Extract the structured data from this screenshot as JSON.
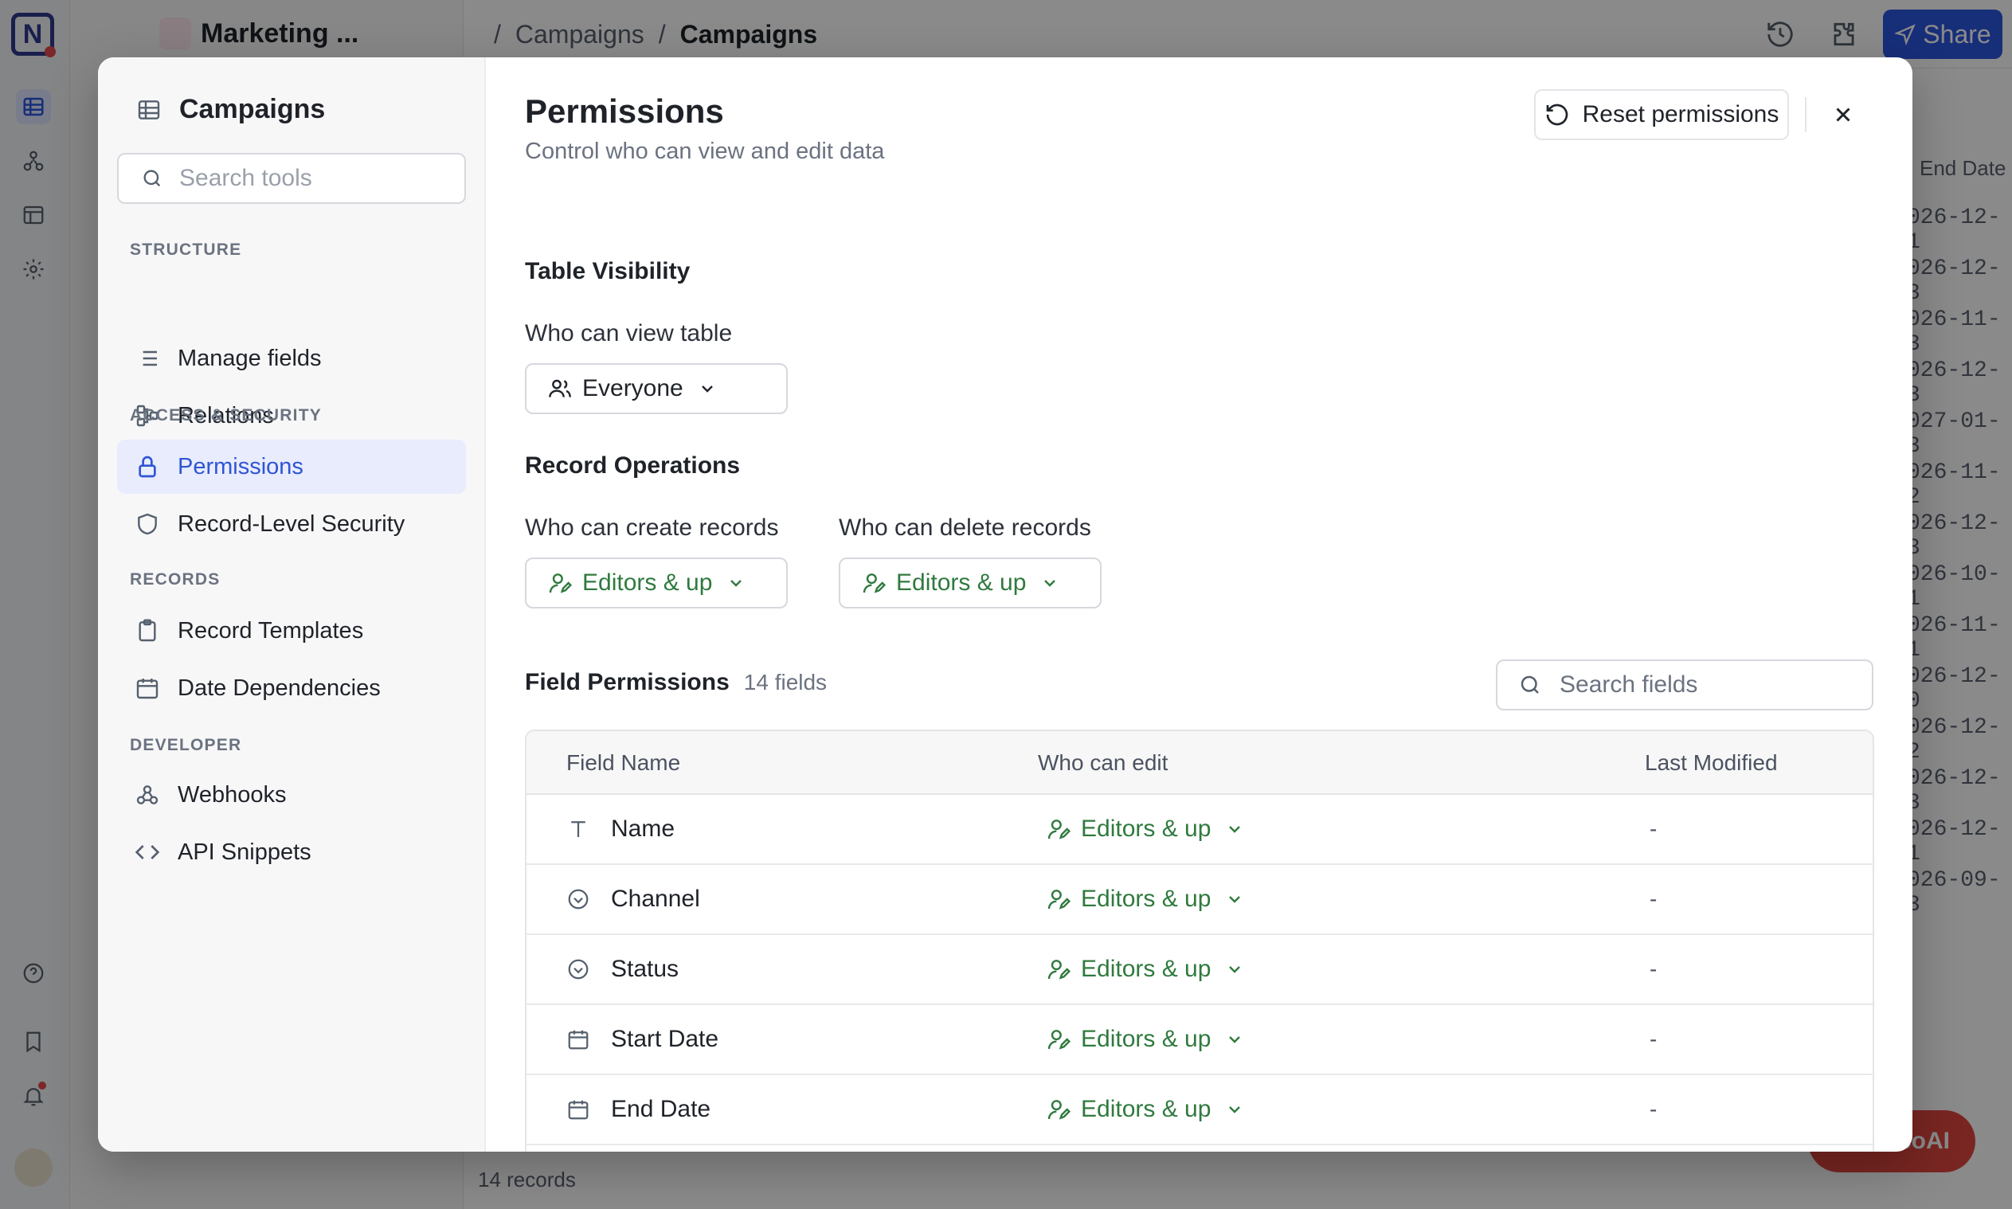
{
  "background": {
    "base_name": "Marketing ...",
    "breadcrumb": [
      "Campaigns",
      "Campaigns"
    ],
    "share_label": "Share",
    "end_date_header": "End Date",
    "dates": [
      "026-12-1",
      "026-12-3",
      "026-11-3",
      "026-12-3",
      "027-01-3",
      "026-11-2",
      "026-12-3",
      "026-10-1",
      "026-11-1",
      "026-12-0",
      "026-12-2",
      "026-12-3",
      "026-12-1",
      "026-09-3"
    ],
    "records_count": "14 records",
    "ai_label": "coAI"
  },
  "sidebar": {
    "title": "Campaigns",
    "search_placeholder": "Search tools",
    "sections": {
      "structure": "STRUCTURE",
      "access": "ACCESS & SECURITY",
      "records": "RECORDS",
      "developer": "DEVELOPER"
    },
    "items": {
      "manage_fields": "Manage fields",
      "relations": "Relations",
      "permissions": "Permissions",
      "rls": "Record-Level Security",
      "templates": "Record Templates",
      "date_deps": "Date Dependencies",
      "webhooks": "Webhooks",
      "api": "API Snippets"
    }
  },
  "main": {
    "title": "Permissions",
    "subtitle": "Control who can view and edit data",
    "reset_label": "Reset permissions",
    "table_visibility": {
      "heading": "Table Visibility",
      "label": "Who can view table",
      "value": "Everyone"
    },
    "record_ops": {
      "heading": "Record Operations",
      "create_label": "Who can create records",
      "create_value": "Editors & up",
      "delete_label": "Who can delete records",
      "delete_value": "Editors & up"
    },
    "field_permissions": {
      "heading": "Field Permissions",
      "count": "14 fields",
      "search_placeholder": "Search fields",
      "columns": [
        "Field Name",
        "Who can edit",
        "Last Modified"
      ],
      "rows": [
        {
          "name": "Name",
          "icon": "text-icon",
          "editor": "Editors & up",
          "modified": "-"
        },
        {
          "name": "Channel",
          "icon": "select-icon",
          "editor": "Editors & up",
          "modified": "-"
        },
        {
          "name": "Status",
          "icon": "select-icon",
          "editor": "Editors & up",
          "modified": "-"
        },
        {
          "name": "Start Date",
          "icon": "calendar-icon",
          "editor": "Editors & up",
          "modified": "-"
        },
        {
          "name": "End Date",
          "icon": "calendar-icon",
          "editor": "Editors & up",
          "modified": "-"
        }
      ]
    }
  }
}
